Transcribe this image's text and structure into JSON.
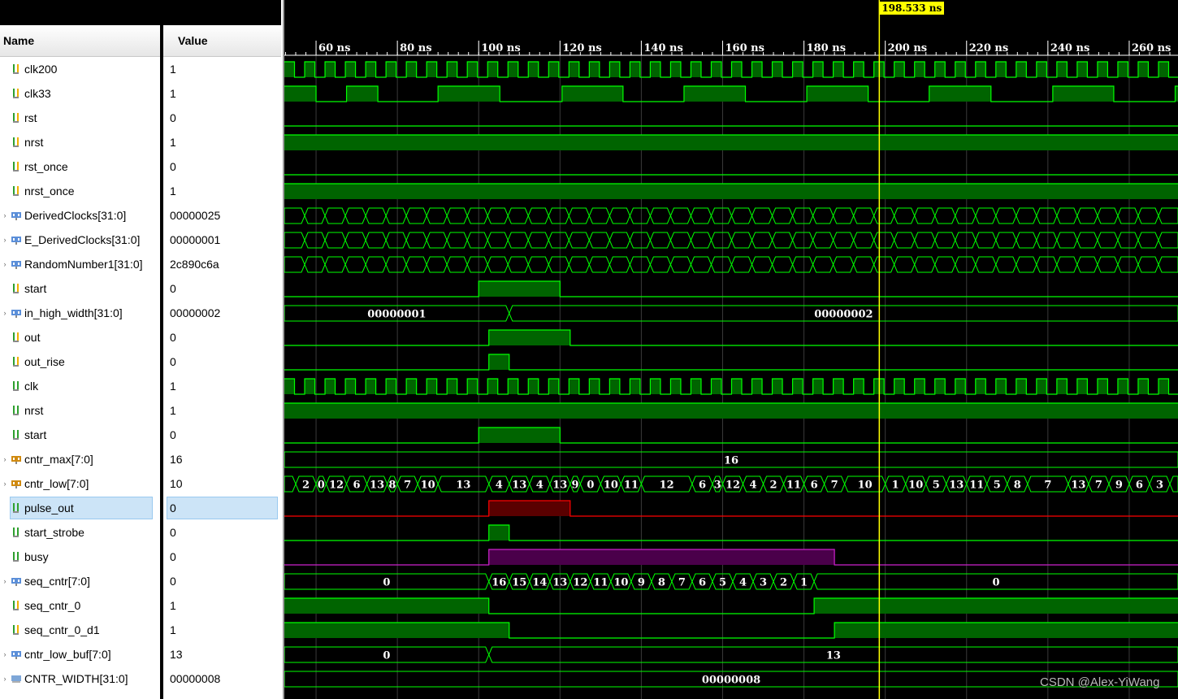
{
  "panel": {
    "name_header": "Name",
    "value_header": "Value"
  },
  "timeline": {
    "ticks": [
      {
        "t": 60,
        "label": "60 ns"
      },
      {
        "t": 80,
        "label": "80 ns"
      },
      {
        "t": 100,
        "label": "100 ns"
      },
      {
        "t": 120,
        "label": "120 ns"
      },
      {
        "t": 140,
        "label": "140 ns"
      },
      {
        "t": 160,
        "label": "160 ns"
      },
      {
        "t": 180,
        "label": "180 ns"
      },
      {
        "t": 200,
        "label": "200 ns"
      },
      {
        "t": 220,
        "label": "220 ns"
      },
      {
        "t": 240,
        "label": "240 ns"
      },
      {
        "t": 260,
        "label": "260 ns"
      }
    ],
    "view_start_ns": 52.2,
    "view_end_ns": 272,
    "cursor_ns": 198.533,
    "cursor_label": "198.533 ns"
  },
  "colors": {
    "wave": "#00ff00",
    "fill": "#006400",
    "selected": "#ff0000",
    "selected_fill": "#5a0000",
    "magenta": "#cc22cc",
    "magenta_fill": "#4a004a",
    "cursor": "#ffff00",
    "grid": "#1e1e1e"
  },
  "signals": [
    {
      "name": "clk200",
      "value": "1",
      "icon": "bit-icon",
      "expandable": false,
      "wave": {
        "kind": "clock",
        "start": 52.2,
        "high": 2.5,
        "low": 2.5
      }
    },
    {
      "name": "clk33",
      "value": "1",
      "icon": "bit-icon",
      "expandable": false,
      "wave": {
        "kind": "bit",
        "init": 1,
        "edges": [
          60,
          67.5,
          75.2,
          90,
          105.2,
          120.5,
          135.5,
          150.5,
          165.6,
          180.7,
          195.8,
          210.8,
          226,
          241.2,
          256.2,
          271.3
        ]
      }
    },
    {
      "name": "rst",
      "value": "0",
      "icon": "bit-icon",
      "expandable": false,
      "wave": {
        "kind": "bit",
        "init": 0,
        "edges": []
      }
    },
    {
      "name": "nrst",
      "value": "1",
      "icon": "bit-icon",
      "expandable": false,
      "wave": {
        "kind": "bit",
        "init": 1,
        "edges": []
      }
    },
    {
      "name": "rst_once",
      "value": "0",
      "icon": "bit-icon",
      "expandable": false,
      "wave": {
        "kind": "bit",
        "init": 0,
        "edges": []
      }
    },
    {
      "name": "nrst_once",
      "value": "1",
      "icon": "bit-icon",
      "expandable": false,
      "wave": {
        "kind": "bit",
        "init": 1,
        "edges": []
      }
    },
    {
      "name": "DerivedClocks[31:0]",
      "value": "00000025",
      "icon": "bus-icon",
      "expandable": true,
      "wave": {
        "kind": "busclock",
        "start": 52.2,
        "period": 5
      }
    },
    {
      "name": "E_DerivedClocks[31:0]",
      "value": "00000001",
      "icon": "bus-icon",
      "expandable": true,
      "wave": {
        "kind": "busclock",
        "start": 52.2,
        "period": 5
      }
    },
    {
      "name": "RandomNumber1[31:0]",
      "value": "2c890c6a",
      "icon": "bus-icon",
      "expandable": true,
      "wave": {
        "kind": "busclock",
        "start": 52.2,
        "period": 5
      }
    },
    {
      "name": "start",
      "value": "0",
      "icon": "bit-icon",
      "expandable": false,
      "wave": {
        "kind": "bit",
        "init": 0,
        "edges": [
          100,
          120
        ]
      }
    },
    {
      "name": "in_high_width[31:0]",
      "value": "00000002",
      "icon": "bus-icon",
      "expandable": true,
      "wave": {
        "kind": "bus",
        "segments": [
          {
            "t0": 52.2,
            "t1": 107.5,
            "v": "00000001"
          },
          {
            "t0": 107.5,
            "t1": 272,
            "v": "00000002"
          }
        ]
      }
    },
    {
      "name": "out",
      "value": "0",
      "icon": "bit-icon",
      "expandable": false,
      "wave": {
        "kind": "bit",
        "init": 0,
        "edges": [
          102.5,
          122.5
        ]
      }
    },
    {
      "name": "out_rise",
      "value": "0",
      "icon": "bit-icon",
      "expandable": false,
      "wave": {
        "kind": "bit",
        "init": 0,
        "edges": [
          102.5,
          107.5
        ]
      }
    },
    {
      "name": "clk",
      "value": "1",
      "icon": "port-bit-icon",
      "expandable": false,
      "wave": {
        "kind": "clock",
        "start": 52.2,
        "high": 2.5,
        "low": 2.5
      }
    },
    {
      "name": "nrst",
      "value": "1",
      "icon": "port-bit-icon",
      "expandable": false,
      "wave": {
        "kind": "bit",
        "init": 1,
        "edges": []
      }
    },
    {
      "name": "start",
      "value": "0",
      "icon": "port-bit-icon",
      "expandable": false,
      "wave": {
        "kind": "bit",
        "init": 0,
        "edges": [
          100,
          120
        ]
      }
    },
    {
      "name": "cntr_max[7:0]",
      "value": "16",
      "icon": "port-bus-icon",
      "expandable": true,
      "wave": {
        "kind": "bus",
        "segments": [
          {
            "t0": 52.2,
            "t1": 272,
            "v": "16"
          }
        ]
      }
    },
    {
      "name": "cntr_low[7:0]",
      "value": "10",
      "icon": "port-bus-icon",
      "expandable": true,
      "wave": {
        "kind": "bus",
        "segments": [
          {
            "t0": 52.2,
            "t1": 55,
            "v": ""
          },
          {
            "t0": 55,
            "t1": 60,
            "v": "2"
          },
          {
            "t0": 60,
            "t1": 62.5,
            "v": "0"
          },
          {
            "t0": 62.5,
            "t1": 67.5,
            "v": "12"
          },
          {
            "t0": 67.5,
            "t1": 72.5,
            "v": "6"
          },
          {
            "t0": 72.5,
            "t1": 77.5,
            "v": "13"
          },
          {
            "t0": 77.5,
            "t1": 80,
            "v": "8"
          },
          {
            "t0": 80,
            "t1": 85,
            "v": "7"
          },
          {
            "t0": 85,
            "t1": 90,
            "v": "10"
          },
          {
            "t0": 90,
            "t1": 102.5,
            "v": "13"
          },
          {
            "t0": 102.5,
            "t1": 107.5,
            "v": "4"
          },
          {
            "t0": 107.5,
            "t1": 112.5,
            "v": "13"
          },
          {
            "t0": 112.5,
            "t1": 117.5,
            "v": "4"
          },
          {
            "t0": 117.5,
            "t1": 122.5,
            "v": "13"
          },
          {
            "t0": 122.5,
            "t1": 125,
            "v": "9"
          },
          {
            "t0": 125,
            "t1": 130,
            "v": "0"
          },
          {
            "t0": 130,
            "t1": 135,
            "v": "10"
          },
          {
            "t0": 135,
            "t1": 140,
            "v": "11"
          },
          {
            "t0": 140,
            "t1": 152.5,
            "v": "12"
          },
          {
            "t0": 152.5,
            "t1": 157.5,
            "v": "6"
          },
          {
            "t0": 157.5,
            "t1": 160,
            "v": "3"
          },
          {
            "t0": 160,
            "t1": 165,
            "v": "12"
          },
          {
            "t0": 165,
            "t1": 170,
            "v": "4"
          },
          {
            "t0": 170,
            "t1": 175,
            "v": "2"
          },
          {
            "t0": 175,
            "t1": 180,
            "v": "11"
          },
          {
            "t0": 180,
            "t1": 185,
            "v": "6"
          },
          {
            "t0": 185,
            "t1": 190,
            "v": "7"
          },
          {
            "t0": 190,
            "t1": 200,
            "v": "10"
          },
          {
            "t0": 200,
            "t1": 205,
            "v": "1"
          },
          {
            "t0": 205,
            "t1": 210,
            "v": "10"
          },
          {
            "t0": 210,
            "t1": 215,
            "v": "5"
          },
          {
            "t0": 215,
            "t1": 220,
            "v": "13"
          },
          {
            "t0": 220,
            "t1": 225,
            "v": "11"
          },
          {
            "t0": 225,
            "t1": 230,
            "v": "5"
          },
          {
            "t0": 230,
            "t1": 235,
            "v": "8"
          },
          {
            "t0": 235,
            "t1": 245,
            "v": "7"
          },
          {
            "t0": 245,
            "t1": 250,
            "v": "13"
          },
          {
            "t0": 250,
            "t1": 255,
            "v": "7"
          },
          {
            "t0": 255,
            "t1": 260,
            "v": "9"
          },
          {
            "t0": 260,
            "t1": 265,
            "v": "6"
          },
          {
            "t0": 265,
            "t1": 270,
            "v": "3"
          },
          {
            "t0": 270,
            "t1": 272,
            "v": ""
          }
        ]
      }
    },
    {
      "name": "pulse_out",
      "value": "0",
      "icon": "port-bit-icon",
      "expandable": false,
      "selected": true,
      "color": "red",
      "wave": {
        "kind": "bit",
        "init": 0,
        "edges": [
          102.5,
          122.5
        ]
      }
    },
    {
      "name": "start_strobe",
      "value": "0",
      "icon": "port-bit-icon",
      "expandable": false,
      "wave": {
        "kind": "bit",
        "init": 0,
        "edges": [
          102.5,
          107.5
        ]
      }
    },
    {
      "name": "busy",
      "value": "0",
      "icon": "port-bit-icon",
      "expandable": false,
      "color": "magenta",
      "wave": {
        "kind": "bit",
        "init": 0,
        "edges": [
          102.5,
          187.5
        ]
      }
    },
    {
      "name": "seq_cntr[7:0]",
      "value": "0",
      "icon": "bus-icon",
      "expandable": true,
      "wave": {
        "kind": "bus",
        "segments": [
          {
            "t0": 52.2,
            "t1": 102.5,
            "v": "0"
          },
          {
            "t0": 102.5,
            "t1": 107.5,
            "v": "16"
          },
          {
            "t0": 107.5,
            "t1": 112.5,
            "v": "15"
          },
          {
            "t0": 112.5,
            "t1": 117.5,
            "v": "14"
          },
          {
            "t0": 117.5,
            "t1": 122.5,
            "v": "13"
          },
          {
            "t0": 122.5,
            "t1": 127.5,
            "v": "12"
          },
          {
            "t0": 127.5,
            "t1": 132.5,
            "v": "11"
          },
          {
            "t0": 132.5,
            "t1": 137.5,
            "v": "10"
          },
          {
            "t0": 137.5,
            "t1": 142.5,
            "v": "9"
          },
          {
            "t0": 142.5,
            "t1": 147.5,
            "v": "8"
          },
          {
            "t0": 147.5,
            "t1": 152.5,
            "v": "7"
          },
          {
            "t0": 152.5,
            "t1": 157.5,
            "v": "6"
          },
          {
            "t0": 157.5,
            "t1": 162.5,
            "v": "5"
          },
          {
            "t0": 162.5,
            "t1": 167.5,
            "v": "4"
          },
          {
            "t0": 167.5,
            "t1": 172.5,
            "v": "3"
          },
          {
            "t0": 172.5,
            "t1": 177.5,
            "v": "2"
          },
          {
            "t0": 177.5,
            "t1": 182.5,
            "v": "1"
          },
          {
            "t0": 182.5,
            "t1": 272,
            "v": "0"
          }
        ]
      }
    },
    {
      "name": "seq_cntr_0",
      "value": "1",
      "icon": "bit-icon",
      "expandable": false,
      "wave": {
        "kind": "bit",
        "init": 1,
        "edges": [
          102.5,
          182.5
        ]
      }
    },
    {
      "name": "seq_cntr_0_d1",
      "value": "1",
      "icon": "bit-icon",
      "expandable": false,
      "wave": {
        "kind": "bit",
        "init": 1,
        "edges": [
          107.5,
          187.5
        ]
      }
    },
    {
      "name": "cntr_low_buf[7:0]",
      "value": "13",
      "icon": "bus-icon",
      "expandable": true,
      "wave": {
        "kind": "bus",
        "segments": [
          {
            "t0": 52.2,
            "t1": 102.5,
            "v": "0"
          },
          {
            "t0": 102.5,
            "t1": 272,
            "v": "13"
          }
        ]
      }
    },
    {
      "name": "CNTR_WIDTH[31:0]",
      "value": "00000008",
      "icon": "param-icon",
      "expandable": true,
      "wave": {
        "kind": "bus",
        "segments": [
          {
            "t0": 52.2,
            "t1": 272,
            "v": "00000008"
          }
        ]
      }
    }
  ],
  "watermark": "CSDN @Alex-YiWang"
}
